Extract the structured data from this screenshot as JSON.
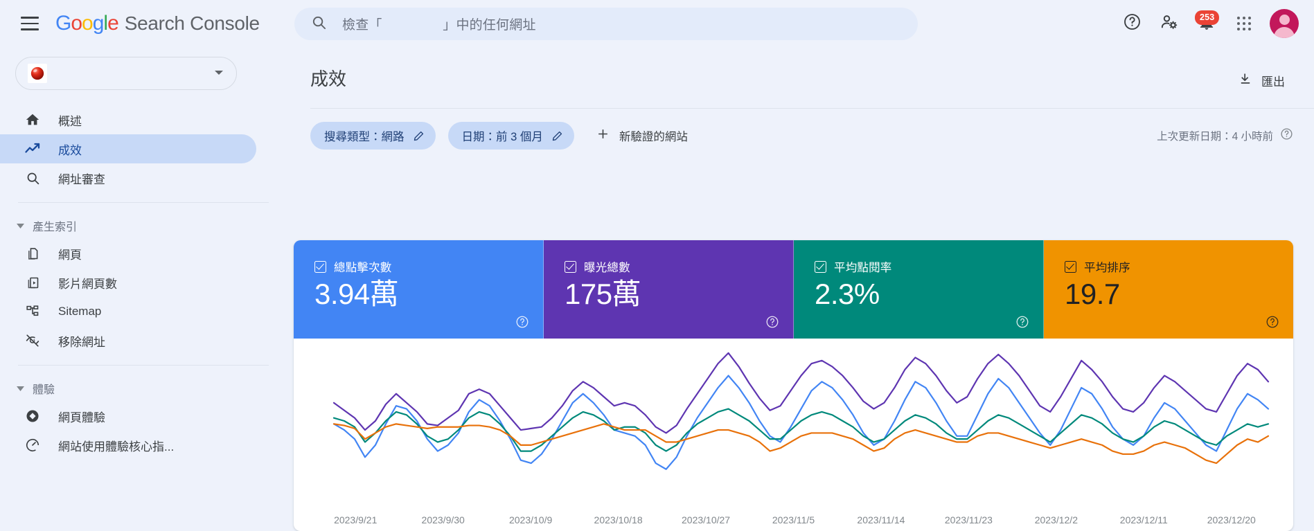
{
  "app": {
    "brand_google": "Google",
    "brand_product": "Search Console"
  },
  "search": {
    "placeholder": "檢查「                」中的任何網址",
    "icon": "search-icon"
  },
  "topbar": {
    "help_icon": "help-circle-icon",
    "account_settings_icon": "person-gear-icon",
    "notifications_icon": "bell-icon",
    "notifications_count": "253",
    "apps_icon": "grid-apps-icon",
    "avatar_icon": "user-avatar"
  },
  "sidebar": {
    "property": {
      "name": "",
      "favicon": "red-sphere-favicon",
      "caret_icon": "chevron-down-icon"
    },
    "items": [
      {
        "label": "概述",
        "icon": "home-icon",
        "active": false
      },
      {
        "label": "成效",
        "icon": "trending-up-icon",
        "active": true
      },
      {
        "label": "網址審查",
        "icon": "search-icon",
        "active": false
      }
    ],
    "groups": [
      {
        "label": "產生索引",
        "icon": "triangle-down-icon",
        "items": [
          {
            "label": "網頁",
            "icon": "pages-copy-icon"
          },
          {
            "label": "影片網頁數",
            "icon": "video-page-icon"
          },
          {
            "label": "Sitemap",
            "icon": "sitemap-icon"
          },
          {
            "label": "移除網址",
            "icon": "eye-off-icon"
          }
        ]
      },
      {
        "label": "體驗",
        "icon": "triangle-down-icon",
        "items": [
          {
            "label": "網頁體驗",
            "icon": "diamond-icon"
          },
          {
            "label": "網站使用體驗核心指...",
            "icon": "speedometer-icon"
          }
        ]
      }
    ]
  },
  "main": {
    "page_title": "成效",
    "export": {
      "label": "匯出",
      "icon": "download-icon"
    },
    "filters": [
      {
        "label": "搜尋類型：網路",
        "edit_icon": "pencil-icon"
      },
      {
        "label": "日期：前 3 個月",
        "edit_icon": "pencil-icon"
      }
    ],
    "add_property": {
      "label": "新驗證的網站",
      "icon": "plus-icon"
    },
    "last_updated": {
      "label": "上次更新日期：4 小時前",
      "icon": "help-circle-icon"
    }
  },
  "metrics": [
    {
      "label": "總點擊次數",
      "value": "3.94萬",
      "color": "#4285F4",
      "text_color": "#ffffff",
      "checked": true
    },
    {
      "label": "曝光總數",
      "value": "175萬",
      "color": "#5E35B1",
      "text_color": "#ffffff",
      "checked": true
    },
    {
      "label": "平均點閱率",
      "value": "2.3%",
      "color": "#00897B",
      "text_color": "#ffffff",
      "checked": true
    },
    {
      "label": "平均排序",
      "value": "19.7",
      "color": "#F09300",
      "text_color": "#202124",
      "checked": true
    }
  ],
  "chart_data": {
    "type": "line",
    "title": "成效",
    "xlabel": "",
    "ylabel": "",
    "grid": false,
    "legend": "metric-cards-above",
    "x_tick_labels": [
      "2023/9/21",
      "2023/9/30",
      "2023/10/9",
      "2023/10/18",
      "2023/10/27",
      "2023/11/5",
      "2023/11/14",
      "2023/11/23",
      "2023/12/2",
      "2023/12/11",
      "2023/12/20"
    ],
    "x_start": "2023/9/21",
    "x_end": "2023/12/20",
    "n_points": 91,
    "series": [
      {
        "name": "曝光總數",
        "color": "#5E35B1",
        "values": [
          62,
          57,
          52,
          44,
          50,
          61,
          68,
          62,
          56,
          48,
          47,
          52,
          57,
          68,
          71,
          68,
          60,
          52,
          44,
          45,
          46,
          52,
          60,
          70,
          76,
          72,
          66,
          60,
          62,
          60,
          54,
          46,
          42,
          47,
          58,
          68,
          78,
          88,
          95,
          86,
          75,
          65,
          57,
          60,
          70,
          80,
          88,
          90,
          86,
          80,
          72,
          63,
          58,
          62,
          72,
          84,
          92,
          88,
          80,
          70,
          62,
          66,
          78,
          88,
          94,
          88,
          80,
          70,
          60,
          56,
          66,
          78,
          90,
          84,
          76,
          66,
          58,
          56,
          62,
          72,
          80,
          76,
          70,
          64,
          58,
          56,
          68,
          80,
          88,
          84,
          76
        ]
      },
      {
        "name": "總點擊次數",
        "color": "#4285F4",
        "values": [
          48,
          44,
          38,
          26,
          34,
          48,
          60,
          58,
          50,
          38,
          30,
          34,
          42,
          56,
          64,
          60,
          50,
          38,
          24,
          22,
          28,
          38,
          50,
          62,
          68,
          62,
          54,
          44,
          42,
          40,
          34,
          22,
          18,
          26,
          40,
          52,
          62,
          72,
          80,
          72,
          62,
          50,
          40,
          36,
          46,
          58,
          70,
          76,
          72,
          64,
          54,
          42,
          34,
          38,
          50,
          64,
          76,
          72,
          62,
          50,
          40,
          40,
          54,
          68,
          78,
          72,
          62,
          52,
          42,
          34,
          44,
          58,
          72,
          68,
          58,
          46,
          38,
          34,
          40,
          52,
          62,
          58,
          50,
          42,
          34,
          30,
          44,
          58,
          68,
          64,
          58
        ]
      },
      {
        "name": "平均點閱率",
        "color": "#00897B",
        "values": [
          52,
          50,
          46,
          36,
          42,
          50,
          56,
          54,
          48,
          40,
          36,
          38,
          44,
          52,
          56,
          54,
          48,
          40,
          30,
          30,
          34,
          40,
          46,
          52,
          56,
          54,
          50,
          44,
          46,
          46,
          42,
          34,
          30,
          34,
          42,
          48,
          52,
          56,
          58,
          54,
          50,
          44,
          38,
          38,
          44,
          50,
          54,
          56,
          54,
          50,
          46,
          40,
          36,
          38,
          44,
          50,
          54,
          52,
          48,
          42,
          38,
          38,
          44,
          50,
          54,
          52,
          48,
          44,
          40,
          36,
          42,
          48,
          54,
          52,
          48,
          42,
          38,
          36,
          40,
          46,
          50,
          48,
          44,
          40,
          36,
          34,
          40,
          44,
          48,
          46,
          48
        ]
      },
      {
        "name": "平均排序",
        "color": "#E8710A",
        "values": [
          48,
          47,
          45,
          38,
          42,
          46,
          48,
          47,
          46,
          45,
          46,
          46,
          46,
          47,
          47,
          46,
          44,
          40,
          34,
          34,
          36,
          38,
          40,
          42,
          44,
          46,
          48,
          46,
          44,
          44,
          44,
          40,
          36,
          36,
          38,
          40,
          42,
          44,
          44,
          42,
          40,
          36,
          30,
          32,
          36,
          40,
          42,
          42,
          42,
          40,
          38,
          34,
          30,
          32,
          38,
          42,
          44,
          42,
          40,
          38,
          36,
          36,
          40,
          42,
          42,
          40,
          38,
          36,
          34,
          32,
          34,
          36,
          38,
          36,
          34,
          30,
          28,
          28,
          30,
          34,
          36,
          34,
          32,
          28,
          24,
          22,
          28,
          34,
          38,
          36,
          40
        ]
      }
    ]
  }
}
